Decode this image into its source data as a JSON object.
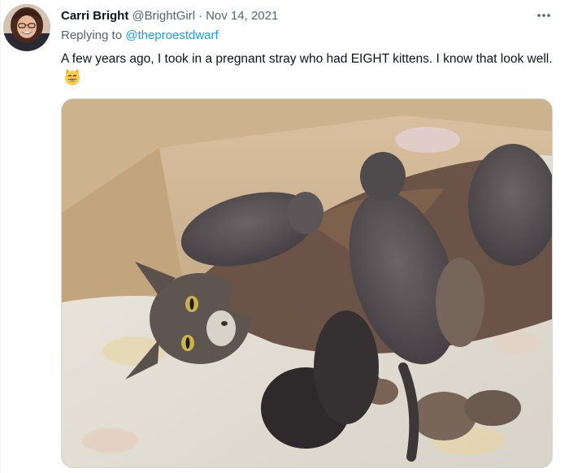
{
  "tweet": {
    "author": {
      "name": "Carri Bright",
      "handle": "@BrightGirl",
      "avatar_icon": "profile-photo"
    },
    "separator": "·",
    "date": "Nov 14, 2021",
    "reply": {
      "prefix": "Replying to",
      "mention": "@theproestdwarf"
    },
    "text": "A few years ago, I took in a pregnant stray who had EIGHT kittens. I know that look well.",
    "emoji_icon": "grinning-cat-smiling-eyes-emoji",
    "more_icon": "more-options-icon",
    "media": {
      "description_icon": "photo-mother-cat-with-kittens"
    }
  },
  "colors": {
    "primary_text": "#0f1419",
    "secondary_text": "#536471",
    "link": "#1d9bf0",
    "border": "#cfd9de"
  }
}
